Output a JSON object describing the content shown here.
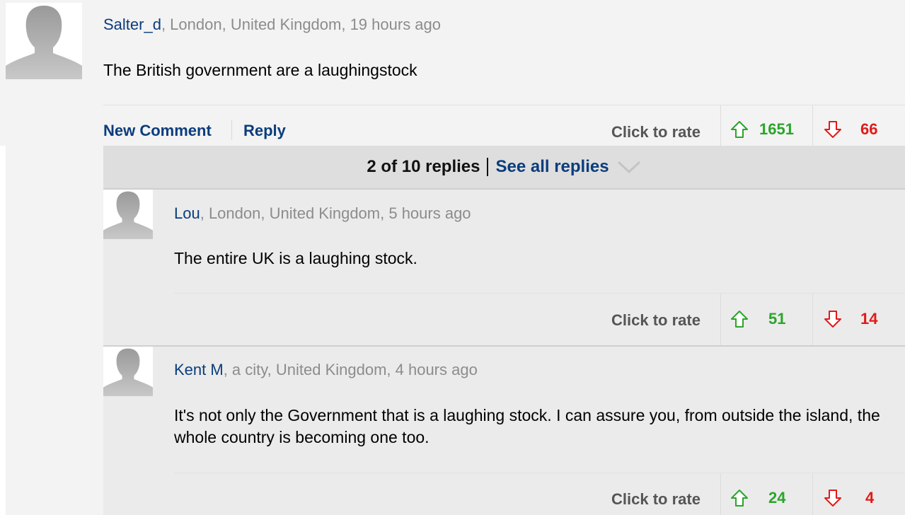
{
  "comment": {
    "author": "Salter_d",
    "meta": ", London, United Kingdom, 19 hours ago",
    "text": "The British government are a laughingstock",
    "new_comment_label": "New Comment",
    "reply_label": "Reply",
    "rate_label": "Click to rate",
    "votes_up": "1651",
    "votes_down": "66"
  },
  "replies_bar": {
    "count_text": "2 of 10 replies",
    "see_all_label": "See all replies"
  },
  "replies": [
    {
      "author": "Lou",
      "meta": ", London, United Kingdom, 5 hours ago",
      "text": "The entire UK is a laughing stock.",
      "rate_label": "Click to rate",
      "votes_up": "51",
      "votes_down": "14"
    },
    {
      "author": "Kent M",
      "meta": ", a city, United Kingdom, 4 hours ago",
      "text": "It's not only the Government that is a laughing stock. I can assure you, from outside the island, the whole country is becoming one too.",
      "rate_label": "Click to rate",
      "votes_up": "24",
      "votes_down": "4"
    }
  ],
  "icons": {
    "avatar": "default-avatar-icon",
    "up": "arrow-up-icon",
    "down": "arrow-down-icon",
    "chevron": "chevron-down-icon"
  },
  "colors": {
    "link": "#0b3d7c",
    "up": "#2ba52b",
    "down": "#e11a1a",
    "meta": "#8c8c8c"
  }
}
